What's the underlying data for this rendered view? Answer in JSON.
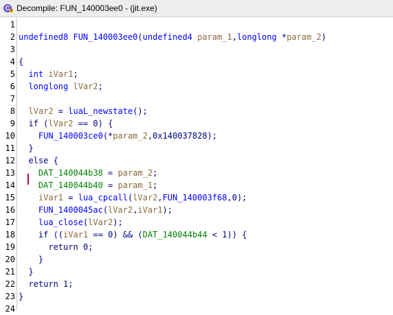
{
  "window": {
    "title": "Decompile: FUN_140003ee0 -  (jit.exe)",
    "icon": "decompiler-icon"
  },
  "code": {
    "lines": [
      {
        "number": "1",
        "tokens": []
      },
      {
        "number": "2",
        "tokens": [
          {
            "t": "undefined8",
            "k": "type"
          },
          {
            "t": " ",
            "k": "plain"
          },
          {
            "t": "FUN_140003ee0",
            "k": "func"
          },
          {
            "t": "(",
            "k": "plain"
          },
          {
            "t": "undefined4",
            "k": "type"
          },
          {
            "t": " ",
            "k": "plain"
          },
          {
            "t": "param_1",
            "k": "param"
          },
          {
            "t": ",",
            "k": "plain"
          },
          {
            "t": "longlong",
            "k": "type"
          },
          {
            "t": " *",
            "k": "plain"
          },
          {
            "t": "param_2",
            "k": "param"
          },
          {
            "t": ")",
            "k": "plain"
          }
        ]
      },
      {
        "number": "3",
        "tokens": []
      },
      {
        "number": "4",
        "tokens": [
          {
            "t": "{",
            "k": "plain"
          }
        ]
      },
      {
        "number": "5",
        "tokens": [
          {
            "t": "  ",
            "k": "plain"
          },
          {
            "t": "int",
            "k": "type"
          },
          {
            "t": " ",
            "k": "plain"
          },
          {
            "t": "iVar1",
            "k": "var"
          },
          {
            "t": ";",
            "k": "plain"
          }
        ]
      },
      {
        "number": "6",
        "tokens": [
          {
            "t": "  ",
            "k": "plain"
          },
          {
            "t": "longlong",
            "k": "type"
          },
          {
            "t": " ",
            "k": "plain"
          },
          {
            "t": "lVar2",
            "k": "var"
          },
          {
            "t": ";",
            "k": "plain"
          }
        ]
      },
      {
        "number": "7",
        "tokens": []
      },
      {
        "number": "8",
        "tokens": [
          {
            "t": "  ",
            "k": "plain"
          },
          {
            "t": "lVar2",
            "k": "var"
          },
          {
            "t": " = ",
            "k": "plain"
          },
          {
            "t": "luaL_newstate",
            "k": "func"
          },
          {
            "t": "();",
            "k": "plain"
          }
        ]
      },
      {
        "number": "9",
        "tokens": [
          {
            "t": "  ",
            "k": "plain"
          },
          {
            "t": "if",
            "k": "kw"
          },
          {
            "t": " (",
            "k": "plain"
          },
          {
            "t": "lVar2",
            "k": "var"
          },
          {
            "t": " == ",
            "k": "plain"
          },
          {
            "t": "0",
            "k": "num"
          },
          {
            "t": ") {",
            "k": "plain"
          }
        ]
      },
      {
        "number": "10",
        "tokens": [
          {
            "t": "    ",
            "k": "plain"
          },
          {
            "t": "FUN_140003ce0",
            "k": "func"
          },
          {
            "t": "(*",
            "k": "plain"
          },
          {
            "t": "param_2",
            "k": "param"
          },
          {
            "t": ",",
            "k": "plain"
          },
          {
            "t": "0x140037828",
            "k": "num"
          },
          {
            "t": ");",
            "k": "plain"
          }
        ]
      },
      {
        "number": "11",
        "tokens": [
          {
            "t": "  }",
            "k": "plain"
          }
        ]
      },
      {
        "number": "12",
        "tokens": [
          {
            "t": "  ",
            "k": "plain"
          },
          {
            "t": "else",
            "k": "kw"
          },
          {
            "t": " {",
            "k": "plain"
          }
        ]
      },
      {
        "number": "13",
        "tokens": [
          {
            "t": "    ",
            "k": "plain"
          },
          {
            "t": "DAT_140044b38",
            "k": "global"
          },
          {
            "t": " = ",
            "k": "plain"
          },
          {
            "t": "param_2",
            "k": "param"
          },
          {
            "t": ";",
            "k": "plain"
          }
        ]
      },
      {
        "number": "14",
        "tokens": [
          {
            "t": "    ",
            "k": "plain"
          },
          {
            "t": "DAT_140044b40",
            "k": "global"
          },
          {
            "t": " = ",
            "k": "plain"
          },
          {
            "t": "param_1",
            "k": "param"
          },
          {
            "t": ";",
            "k": "plain"
          }
        ]
      },
      {
        "number": "15",
        "tokens": [
          {
            "t": "    ",
            "k": "plain"
          },
          {
            "t": "iVar1",
            "k": "var"
          },
          {
            "t": " = ",
            "k": "plain"
          },
          {
            "t": "lua_cpcall",
            "k": "func"
          },
          {
            "t": "(",
            "k": "plain"
          },
          {
            "t": "lVar2",
            "k": "var"
          },
          {
            "t": ",",
            "k": "plain"
          },
          {
            "t": "FUN_140003f68",
            "k": "func"
          },
          {
            "t": ",",
            "k": "plain"
          },
          {
            "t": "0",
            "k": "num"
          },
          {
            "t": ");",
            "k": "plain"
          }
        ]
      },
      {
        "number": "16",
        "tokens": [
          {
            "t": "    ",
            "k": "plain"
          },
          {
            "t": "FUN_1400045ac",
            "k": "func"
          },
          {
            "t": "(",
            "k": "plain"
          },
          {
            "t": "lVar2",
            "k": "var"
          },
          {
            "t": ",",
            "k": "plain"
          },
          {
            "t": "iVar1",
            "k": "var"
          },
          {
            "t": ");",
            "k": "plain"
          }
        ]
      },
      {
        "number": "17",
        "tokens": [
          {
            "t": "    ",
            "k": "plain"
          },
          {
            "t": "lua_close",
            "k": "func"
          },
          {
            "t": "(",
            "k": "plain"
          },
          {
            "t": "lVar2",
            "k": "var"
          },
          {
            "t": ");",
            "k": "plain"
          }
        ]
      },
      {
        "number": "18",
        "tokens": [
          {
            "t": "    ",
            "k": "plain"
          },
          {
            "t": "if",
            "k": "kw"
          },
          {
            "t": " ((",
            "k": "plain"
          },
          {
            "t": "iVar1",
            "k": "var"
          },
          {
            "t": " == ",
            "k": "plain"
          },
          {
            "t": "0",
            "k": "num"
          },
          {
            "t": ") && (",
            "k": "plain"
          },
          {
            "t": "DAT_140044b44",
            "k": "global"
          },
          {
            "t": " < ",
            "k": "plain"
          },
          {
            "t": "1",
            "k": "num"
          },
          {
            "t": ")) {",
            "k": "plain"
          }
        ]
      },
      {
        "number": "19",
        "tokens": [
          {
            "t": "      ",
            "k": "plain"
          },
          {
            "t": "return",
            "k": "kw"
          },
          {
            "t": " ",
            "k": "plain"
          },
          {
            "t": "0",
            "k": "num"
          },
          {
            "t": ";",
            "k": "plain"
          }
        ]
      },
      {
        "number": "20",
        "tokens": [
          {
            "t": "    }",
            "k": "plain"
          }
        ]
      },
      {
        "number": "21",
        "tokens": [
          {
            "t": "  }",
            "k": "plain"
          }
        ]
      },
      {
        "number": "22",
        "tokens": [
          {
            "t": "  ",
            "k": "plain"
          },
          {
            "t": "return",
            "k": "kw"
          },
          {
            "t": " ",
            "k": "plain"
          },
          {
            "t": "1",
            "k": "num"
          },
          {
            "t": ";",
            "k": "plain"
          }
        ]
      },
      {
        "number": "23",
        "tokens": [
          {
            "t": "}",
            "k": "plain"
          }
        ]
      },
      {
        "number": "24",
        "tokens": []
      }
    ]
  },
  "colors": {
    "type": "#0000ff",
    "function": "#0000ff",
    "variable": "#8a6a3a",
    "global": "#008000",
    "plain": "#000080",
    "cursor": "#b0003a"
  }
}
